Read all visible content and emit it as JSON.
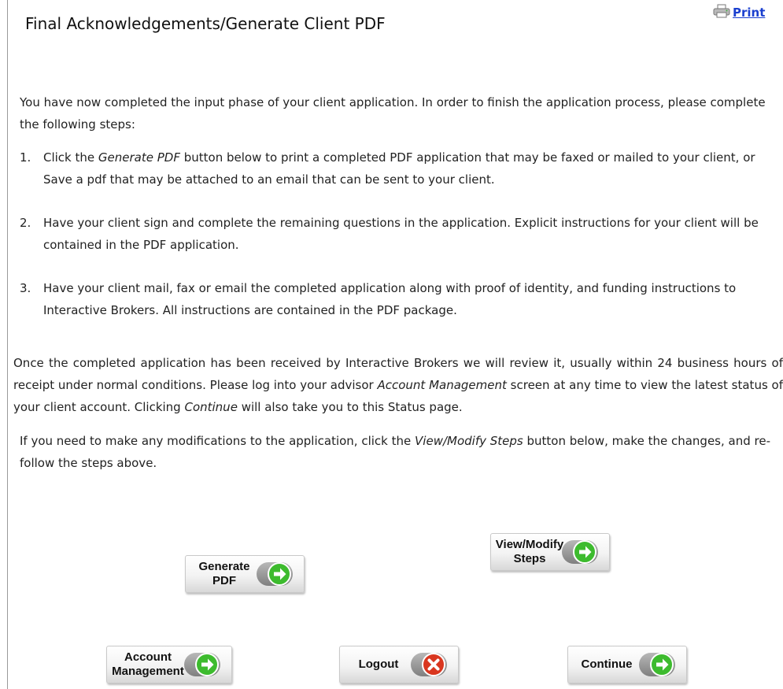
{
  "header": {
    "title": "Final Acknowledgements/Generate Client PDF",
    "print_label": "Print"
  },
  "content": {
    "intro": "You have now completed the input phase of your client application. In order to finish the application process, please complete the following steps:",
    "steps": [
      {
        "number": "1.",
        "before": "Click the ",
        "emphasis": "Generate PDF",
        "after": " button below to print a completed PDF application that may be faxed or mailed to your client, or Save a pdf that may be attached to an email that can be sent to your client."
      },
      {
        "number": "2.",
        "text": "Have your client sign and complete the remaining questions in the application. Explicit instructions for your client will be contained in the PDF application."
      },
      {
        "number": "3.",
        "text": "Have your client mail, fax or email the completed application along with proof of identity, and funding instructions to Interactive Brokers. All instructions are contained in the PDF package."
      }
    ],
    "review": {
      "part1": "Once the completed application has been received by Interactive Brokers we will review it, usually within 24 business hours of receipt under normal conditions. Please log into your advisor ",
      "emphasis1": "Account Management",
      "part2": " screen at any time to view the latest status of your client account. Clicking ",
      "emphasis2": "Continue",
      "part3": " will also take you to this Status page."
    },
    "modify": {
      "part1": "If you need to make any modifications to the application, click the ",
      "emphasis": "View/Modify Steps",
      "part2": " button below, make the changes, and re-follow the steps above."
    }
  },
  "buttons": {
    "generate_pdf": {
      "line1": "Generate",
      "line2": "PDF",
      "icon": "green-arrow-icon"
    },
    "view_modify": {
      "line1": "View/Modify",
      "line2": "Steps",
      "icon": "green-arrow-icon"
    },
    "account_management": {
      "line1": "Account",
      "line2": "Management",
      "icon": "green-arrow-icon"
    },
    "logout": {
      "label": "Logout",
      "icon": "red-x-icon"
    },
    "continue": {
      "label": "Continue",
      "icon": "green-arrow-icon"
    }
  },
  "colors": {
    "link": "#1a3fcf",
    "go_green": "#3dbb2e",
    "stop_red": "#d9361f"
  }
}
